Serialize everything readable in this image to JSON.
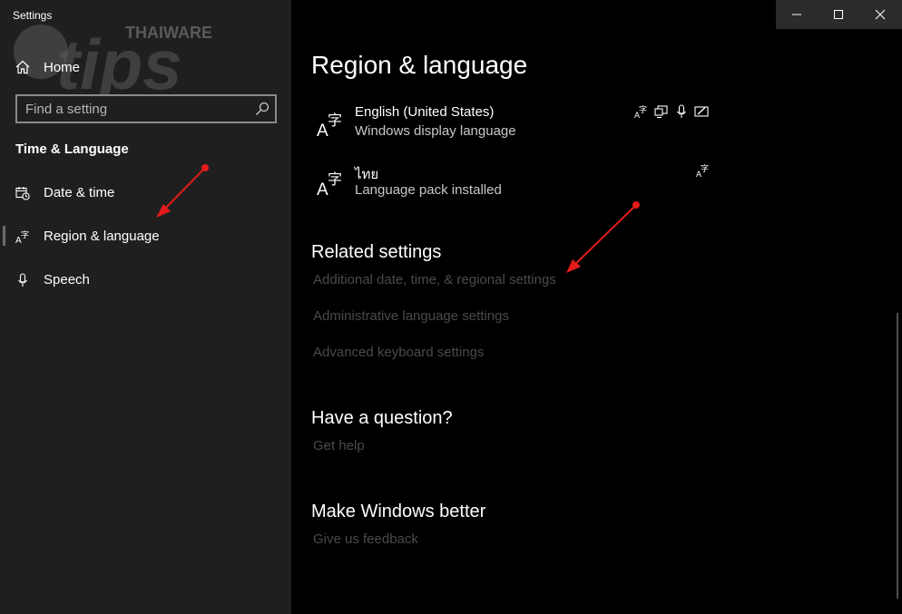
{
  "window": {
    "title": "Settings",
    "controls": {
      "minimize": "—",
      "maximize": "☐",
      "close": "✕"
    }
  },
  "watermark": {
    "brand": "THAIWARE",
    "word": "tips"
  },
  "sidebar": {
    "home_label": "Home",
    "search_placeholder": "Find a setting",
    "section_label": "Time & Language",
    "items": [
      {
        "label": "Date & time",
        "icon": "calendar-clock-icon",
        "selected": false
      },
      {
        "label": "Region & language",
        "icon": "language-icon",
        "selected": true
      },
      {
        "label": "Speech",
        "icon": "microphone-icon",
        "selected": false
      }
    ]
  },
  "main": {
    "title": "Region & language",
    "languages": [
      {
        "name": "English (United States)",
        "status": "Windows display language",
        "features": [
          "language-icon",
          "display-icon",
          "microphone-icon",
          "handwriting-icon"
        ]
      },
      {
        "name": "ไทย",
        "status": "Language pack installed",
        "features": [
          "language-icon"
        ]
      }
    ],
    "related": {
      "heading": "Related settings",
      "links": [
        "Additional date, time, & regional settings",
        "Administrative language settings",
        "Advanced keyboard settings"
      ]
    },
    "question": {
      "heading": "Have a question?",
      "link": "Get help"
    },
    "better": {
      "heading": "Make Windows better",
      "link": "Give us feedback"
    }
  },
  "colors": {
    "sidebar_bg": "#1f1f1f",
    "main_bg": "#000000",
    "link_disabled": "#4a4a4a",
    "annotation_red": "#e31b1b"
  }
}
